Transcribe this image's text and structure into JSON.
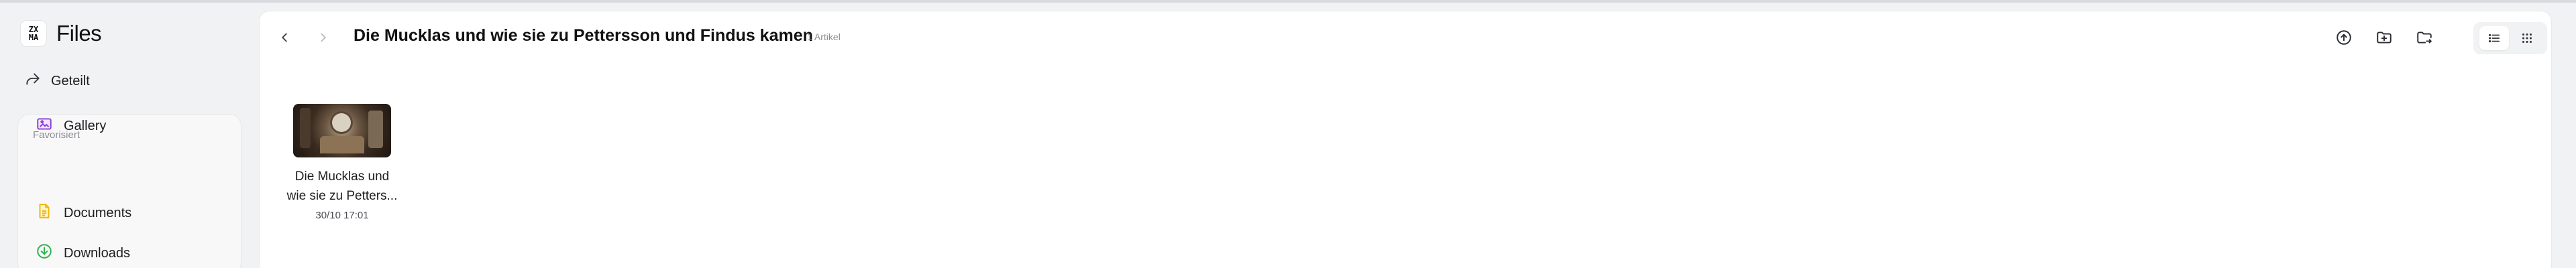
{
  "app": {
    "logo_top": "ZX",
    "logo_bottom": "MA",
    "title": "Files"
  },
  "sidebar": {
    "shared_label": "Geteilt",
    "favorites_heading": "Favorisiert",
    "favorites": [
      {
        "label": "Documents",
        "icon": "document-icon",
        "color": "#f2b705"
      },
      {
        "label": "Downloads",
        "icon": "download-icon",
        "color": "#2bb24c"
      },
      {
        "label": "Gallery",
        "icon": "image-icon",
        "color": "#8b3fd9"
      }
    ]
  },
  "toolbar": {
    "folder_title": "Die Mucklas und wie sie zu Pettersson und Findus kamen",
    "item_count": "1 Artikel",
    "actions": [
      "upload-icon",
      "new-folder-icon",
      "move-folder-icon"
    ],
    "views": [
      "list-view-icon",
      "grid-view-icon"
    ],
    "active_view": "list"
  },
  "files": [
    {
      "name_line1": "Die Mucklas und",
      "name_line2": "wie sie zu Petters...",
      "date": "30/10 17:01"
    }
  ]
}
